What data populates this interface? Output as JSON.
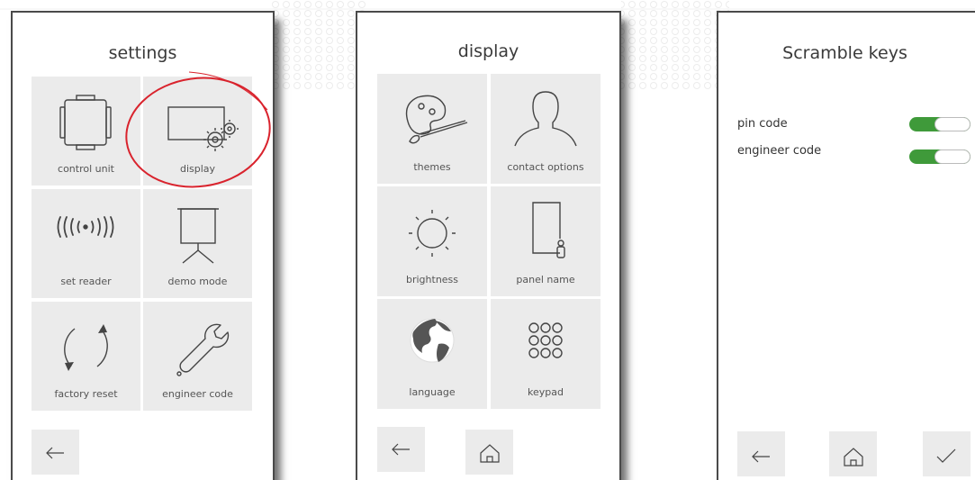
{
  "settings": {
    "title": "settings",
    "tiles": [
      {
        "label": "control unit",
        "icon": "control-unit-icon"
      },
      {
        "label": "display",
        "icon": "display-settings-icon"
      },
      {
        "label": "set reader",
        "icon": "rfid-reader-icon"
      },
      {
        "label": "demo mode",
        "icon": "presentation-screen-icon"
      },
      {
        "label": "factory reset",
        "icon": "reset-cycle-icon"
      },
      {
        "label": "engineer code",
        "icon": "wrench-icon"
      }
    ],
    "back_icon": "arrow-left-icon",
    "highlight_color": "#d9232d"
  },
  "display": {
    "title": "display",
    "tiles": [
      {
        "label": "themes",
        "icon": "palette-icon"
      },
      {
        "label": "contact options",
        "icon": "person-silhouette-icon"
      },
      {
        "label": "brightness",
        "icon": "sun-icon"
      },
      {
        "label": "panel name",
        "icon": "door-panel-icon"
      },
      {
        "label": "language",
        "icon": "globe-icon"
      },
      {
        "label": "keypad",
        "icon": "keypad-dots-icon"
      }
    ],
    "back_icon": "arrow-left-icon",
    "home_icon": "home-icon"
  },
  "scramble": {
    "title": "Scramble keys",
    "options": [
      {
        "label": "pin code",
        "enabled": true
      },
      {
        "label": "engineer code",
        "enabled": true
      }
    ],
    "toggle_color": "#3f9a3a",
    "back_icon": "arrow-left-icon",
    "home_icon": "home-icon",
    "confirm_icon": "checkmark-icon"
  }
}
